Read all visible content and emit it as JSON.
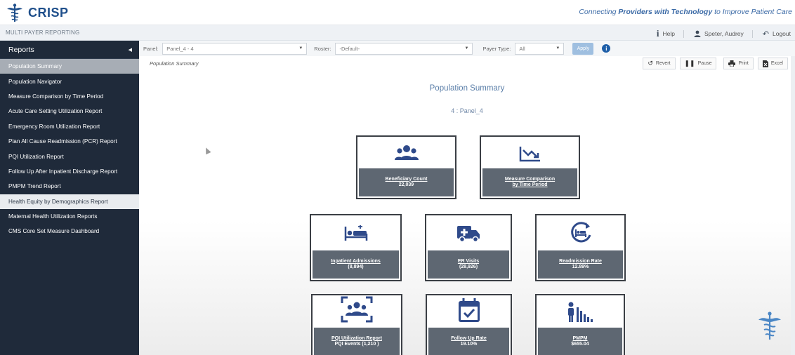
{
  "header": {
    "brand": "CRISP",
    "tagline_prefix": "Connecting ",
    "tagline_bold": "Providers with Technology",
    "tagline_suffix": " to Improve Patient Care"
  },
  "subbar": {
    "title": "MULTI PAYER REPORTING",
    "help": "Help",
    "user": "Speter, Audrey",
    "logout": "Logout"
  },
  "sidebar": {
    "title": "Reports",
    "items": [
      {
        "label": "Population Summary"
      },
      {
        "label": "Population Navigator"
      },
      {
        "label": "Measure Comparison by Time Period"
      },
      {
        "label": "Acute Care Setting Utilization Report"
      },
      {
        "label": "Emergency Room Utilization Report"
      },
      {
        "label": "Plan All Cause Readmission (PCR) Report"
      },
      {
        "label": "PQI Utilization Report"
      },
      {
        "label": "Follow Up After Inpatient Discharge Report"
      },
      {
        "label": "PMPM Trend Report"
      },
      {
        "label": "Health Equity by Demographics Report"
      },
      {
        "label": "Maternal Health Utilization Reports"
      },
      {
        "label": "CMS Core Set Measure Dashboard"
      }
    ]
  },
  "filters": {
    "panel_label": "Panel:",
    "panel_value": "Panel_4 - 4",
    "roster_label": "Roster:",
    "roster_value": "-Default-",
    "payer_label": "Payer Type:",
    "payer_value": "All",
    "apply": "Apply",
    "info": "i"
  },
  "main": {
    "breadcrumb": "Population Summary",
    "title": "Population Summary",
    "panel_sub": "4 : Panel_4",
    "toolbar": {
      "revert": "Revert",
      "pause": "Pause",
      "print": "Print",
      "excel": "Excel"
    },
    "tiles": [
      {
        "label": "Beneficiary Count",
        "value": "22,039",
        "icon": "people-group-icon"
      },
      {
        "label": "Measure Comparison by Time Period",
        "label_l1": "Measure Comparison",
        "label_l2": "by Time Period",
        "icon": "trend-down-chart-icon"
      },
      {
        "label": "Inpatient Admissions",
        "value": "(8,894)",
        "icon": "hospital-bed-icon"
      },
      {
        "label": "ER Visits",
        "value": "(28,926)",
        "icon": "ambulance-icon"
      },
      {
        "label": "Readmission Rate",
        "value": "12.89%",
        "icon": "readmission-bed-icon"
      },
      {
        "label": "PQI Utilization Report",
        "value": "PQI Events (1,210 )",
        "icon": "focus-group-icon"
      },
      {
        "label": "Follow Up Rate",
        "value": "19.10%",
        "icon": "calendar-check-icon"
      },
      {
        "label": "PMPM",
        "value": "$655.04",
        "icon": "person-bar-chart-icon"
      }
    ]
  },
  "colors": {
    "sidebar_bg": "#1f2a3a",
    "brand_blue": "#1f4f8b",
    "tile_icon": "#2f4a8a",
    "tile_footer": "#5e6772"
  }
}
